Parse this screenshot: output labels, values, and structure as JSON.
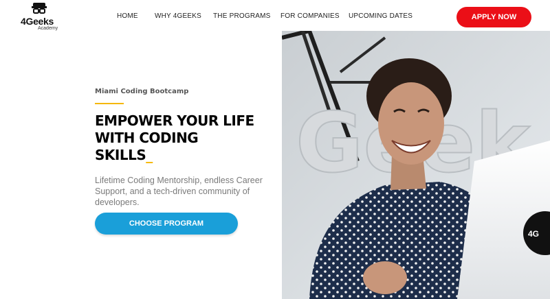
{
  "brand": {
    "name": "4Geeks",
    "sub": "Academy"
  },
  "nav": {
    "items": [
      {
        "label": "HOME"
      },
      {
        "label": "WHY 4GEEKS"
      },
      {
        "label": "THE PROGRAMS"
      },
      {
        "label": "FOR COMPANIES"
      },
      {
        "label": "UPCOMING DATES"
      }
    ],
    "apply_label": "APPLY NOW"
  },
  "hero": {
    "eyebrow": "Miami Coding Bootcamp",
    "headline_lines": [
      "EMPOWER YOUR LIFE",
      "WITH CODING",
      "SKILLS"
    ],
    "cursor": "_",
    "subtext": "Lifetime Coding Mentorship, endless Career Support, and a tech-driven community of developers.",
    "cta_label": "CHOOSE PROGRAM",
    "image": {
      "wall_text": "Geek",
      "badge_text": "4G"
    }
  },
  "colors": {
    "apply": "#eb0f17",
    "cta": "#1a9fd9",
    "accent": "#f5b700"
  }
}
